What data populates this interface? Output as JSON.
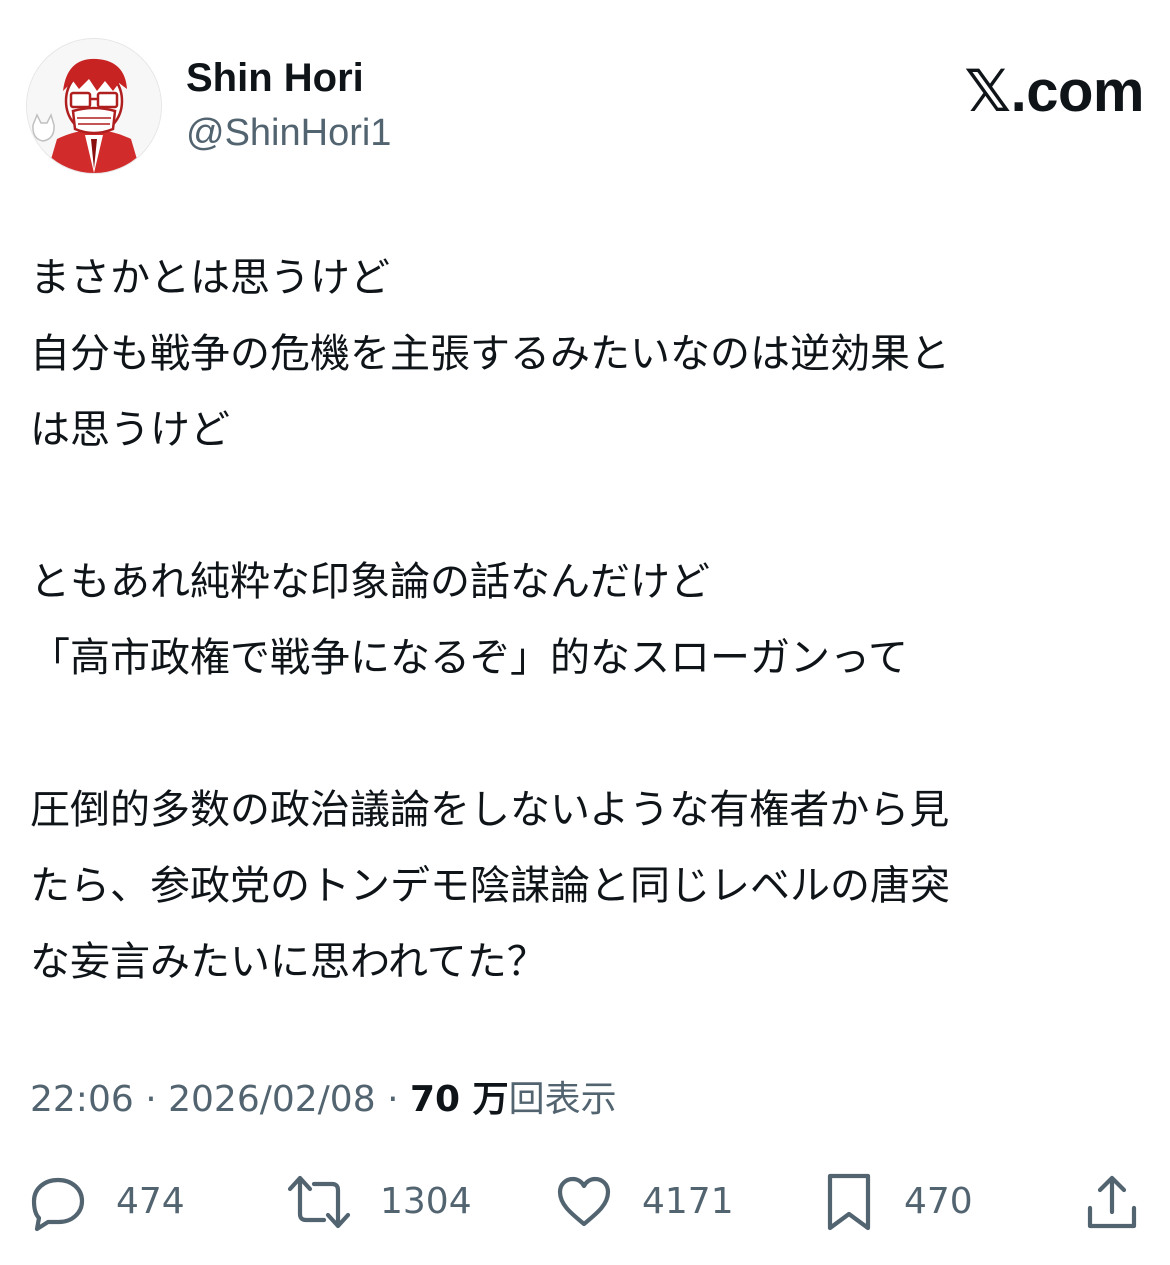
{
  "author": {
    "display_name": "Shin Hori",
    "handle": "@ShinHori1",
    "avatar_icon": "avatar-illustration"
  },
  "brand": {
    "x_glyph": "𝕏",
    "suffix": ".com"
  },
  "tweet": {
    "paragraphs": [
      [
        "まさかとは思うけど",
        "自分も戦争の危機を主張するみたいなのは逆効果と",
        "は思うけど"
      ],
      [
        "ともあれ純粋な印象論の話なんだけど",
        "「高市政権で戦争になるぞ」的なスローガンって"
      ],
      [
        "圧倒的多数の政治議論をしないような有権者から見",
        "たら、参政党のトンデモ陰謀論と同じレベルの唐突",
        "な妄言みたいに思われてた？"
      ]
    ]
  },
  "meta": {
    "time": "22:06",
    "separator": "·",
    "date": "2026/02/08",
    "views_number": "70 万",
    "views_label": "回表示"
  },
  "actions": {
    "reply": {
      "icon": "reply-icon",
      "count": "474"
    },
    "repost": {
      "icon": "repost-icon",
      "count": "1304"
    },
    "like": {
      "icon": "like-icon",
      "count": "4171"
    },
    "bookmark": {
      "icon": "bookmark-icon",
      "count": "470"
    },
    "share": {
      "icon": "share-icon"
    }
  },
  "colors": {
    "text": "#0f1419",
    "secondary": "#536471",
    "avatar_accent": "#d22b2b"
  }
}
